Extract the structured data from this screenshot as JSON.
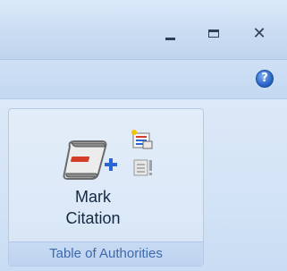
{
  "window": {
    "minimize_icon": "minimize-icon",
    "maximize_icon": "maximize-icon",
    "close_icon": "close-icon"
  },
  "help": {
    "icon": "help-icon",
    "glyph": "?"
  },
  "ribbon": {
    "group": {
      "label": "Table of Authorities",
      "mark_citation": {
        "line1": "Mark",
        "line2": "Citation",
        "icon": "mark-citation-icon"
      },
      "small_buttons": [
        {
          "icon": "insert-table-of-authorities-icon"
        },
        {
          "icon": "update-table-icon"
        }
      ]
    }
  },
  "colors": {
    "ribbon_bg": "#d3e3f6",
    "group_label_text": "#3e6aaa",
    "button_text": "#15283f",
    "accent_blue": "#2c66c8"
  }
}
